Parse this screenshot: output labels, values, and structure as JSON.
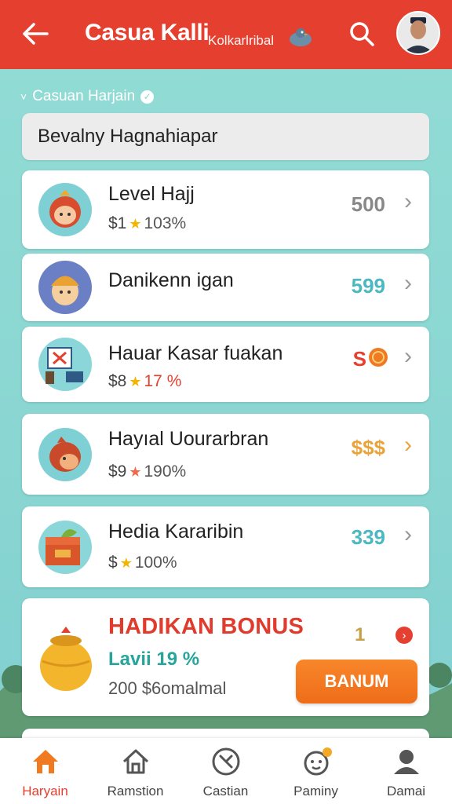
{
  "header": {
    "title": "Casua Kalli",
    "subtitle": "Kolkarlribal",
    "back_icon": "arrow-left-icon",
    "search_icon": "search-icon"
  },
  "breadcrumb": {
    "label": "Casuan Harjain"
  },
  "banner": {
    "text": "Bevalny Hagnahiapar"
  },
  "items": [
    {
      "name": "Level Hajj",
      "prefix": "$1",
      "pct": "103%",
      "value": "500",
      "value_color": "#888888"
    },
    {
      "name": "Danikenn igan",
      "prefix": "",
      "pct": "",
      "value": "599",
      "value_color": "#4bb8c2"
    },
    {
      "name": "Hauar Kasar fuakan",
      "prefix": "$8",
      "pct": "17 %",
      "value": "S",
      "value_color": "#e5402f"
    },
    {
      "name": "Hayıal Uourarbran",
      "prefix": "$9",
      "pct": "190%",
      "value": "$$$",
      "value_color": "#e9a33a"
    },
    {
      "name": "Hedia Kararibin",
      "prefix": "$",
      "pct": "100%",
      "value": "339",
      "value_color": "#4bb8c2"
    }
  ],
  "bonus": {
    "title": "HADIKAN BONUS",
    "level": "Lavii 19 %",
    "coins": "200 $6omalmal",
    "count": "1",
    "button": "BANUM"
  },
  "nav": [
    {
      "label": "Haryain",
      "icon": "home-icon",
      "active": true
    },
    {
      "label": "Ramstion",
      "icon": "house-outline-icon",
      "active": false
    },
    {
      "label": "Castian",
      "icon": "compass-icon",
      "active": false
    },
    {
      "label": "Paminy",
      "icon": "pet-icon",
      "active": false
    },
    {
      "label": "Damai",
      "icon": "profile-icon",
      "active": false
    }
  ],
  "colors": {
    "header": "#e5402f",
    "background": "#8ad6d2",
    "accent": "#f07a22"
  }
}
